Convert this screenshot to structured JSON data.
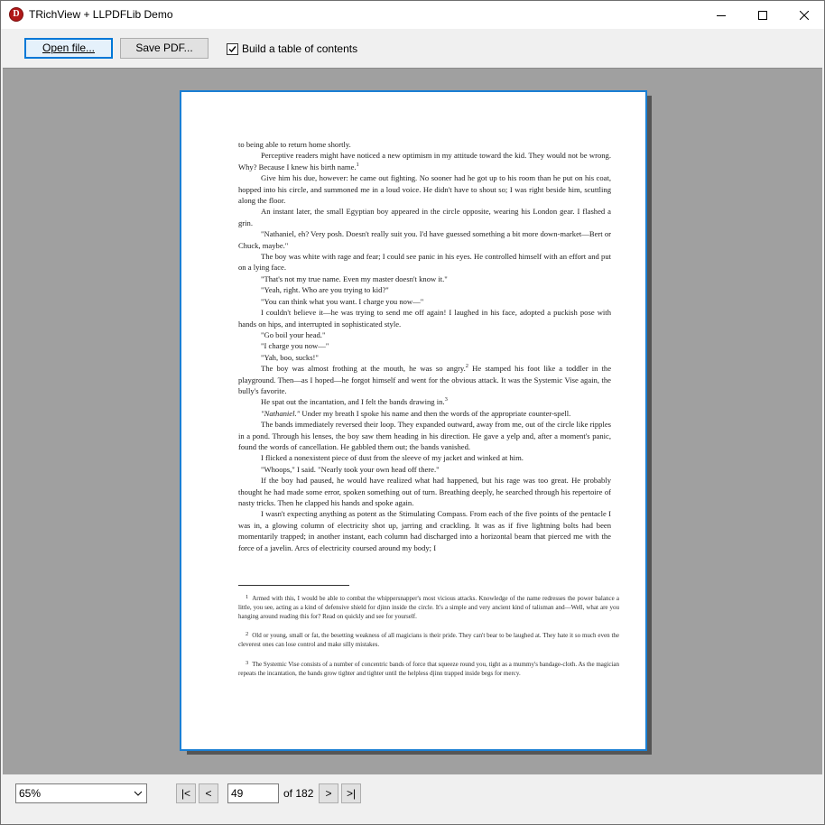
{
  "window": {
    "title": "TRichView + LLPDFLib Demo",
    "app_icon_letter": "D"
  },
  "toolbar": {
    "open_label": "Open file...",
    "save_label": "Save PDF...",
    "toc_label": "Build a table of contents",
    "toc_checked": true
  },
  "document": {
    "paragraphs": [
      "to being able to return home shortly.",
      "Perceptive readers might have noticed a new optimism in my attitude toward the kid. They would not be wrong. Why? Because I knew his birth name.",
      "Give him his due, however: he came out fighting. No sooner had he got up to his room than he put on his coat, hopped into his circle, and summoned me in a loud voice. He didn't have to shout so; I was right beside him, scuttling along the floor.",
      "An instant later, the small Egyptian boy appeared in the circle opposite, wearing his London gear. I flashed a grin.",
      "\"Nathaniel, eh? Very posh. Doesn't really suit you. I'd have guessed something a bit more down-market—Bert or Chuck, maybe.\"",
      "The boy was white with rage and fear; I could see panic in his eyes. He controlled himself with an effort and put on a lying face.",
      "\"That's not my true name. Even my master doesn't know it.\"",
      "\"Yeah, right. Who are you trying to kid?\"",
      "\"You can think what you want. I charge you now—\"",
      "I couldn't believe it—he was trying to send me off again! I laughed in his face, adopted a puckish pose with hands on hips, and interrupted in sophisticated style.",
      "\"Go boil your head.\"",
      "\"I charge you now—\"",
      "\"Yah, boo, sucks!\"",
      "The boy was almost frothing at the mouth, he was so angry. He stamped his foot like a toddler in the playground. Then—as I hoped—he forgot himself and went for the obvious attack. It was the Systemic Vise again, the bully's favorite.",
      "He spat out the incantation, and I felt the bands drawing in.",
      "Under my breath I spoke his name and then the words of the appropriate counter-spell.",
      "The bands immediately reversed their loop. They expanded outward, away from me, out of the circle like ripples in a pond. Through his lenses, the boy saw them heading in his direction. He gave a yelp and, after a moment's panic, found the words of cancellation. He gabbled them out; the bands vanished.",
      "I flicked a nonexistent piece of dust from the sleeve of my jacket and winked at him.",
      "\"Whoops,\" I said. \"Nearly took your own head off there.\"",
      "If the boy had paused, he would have realized what had happened, but his rage was too great. He probably thought he had made some error, spoken something out of turn. Breathing deeply, he searched through his repertoire of nasty tricks. Then he clapped his hands and spoke again.",
      "I wasn't expecting anything as potent as the Stimulating Compass. From each of the five points of the pentacle I was in, a glowing column of electricity shot up, jarring and crackling. It was as if five lightning bolts had been momentarily trapped; in another instant, each column had discharged into a horizontal beam that pierced me with the force of a javelin. Arcs of electricity coursed around my body; I"
    ],
    "italic_phrase": "\"Nathaniel.\"",
    "footnote_marks": [
      "1",
      "2",
      "3"
    ],
    "footnotes": [
      "Armed with this, I would be able to combat the whippersnapper's most vicious attacks. Knowledge of the name redresses the power balance a little, you see, acting as a kind of defensive shield for djinn inside the circle. It's a simple and very ancient kind of talisman and—Well, what are you hanging around reading this for? Read on quickly and see for yourself.",
      "Old or young, small or fat, the besetting weakness of all magicians is their pride. They can't bear to be laughed at. They hate it so much even the cleverest ones can lose control and make silly mistakes.",
      "The Systemic Vise consists of a number of concentric bands of force that squeeze round you, tight as a mummy's bandage-cloth. As the magician repeats the incantation, the bands grow tighter and tighter until the helpless djinn trapped inside begs for mercy."
    ]
  },
  "bottom": {
    "zoom": "65%",
    "first_label": "|<",
    "prev_label": "<",
    "page": "49",
    "of_label": "of 182",
    "next_label": ">",
    "last_label": ">|"
  }
}
